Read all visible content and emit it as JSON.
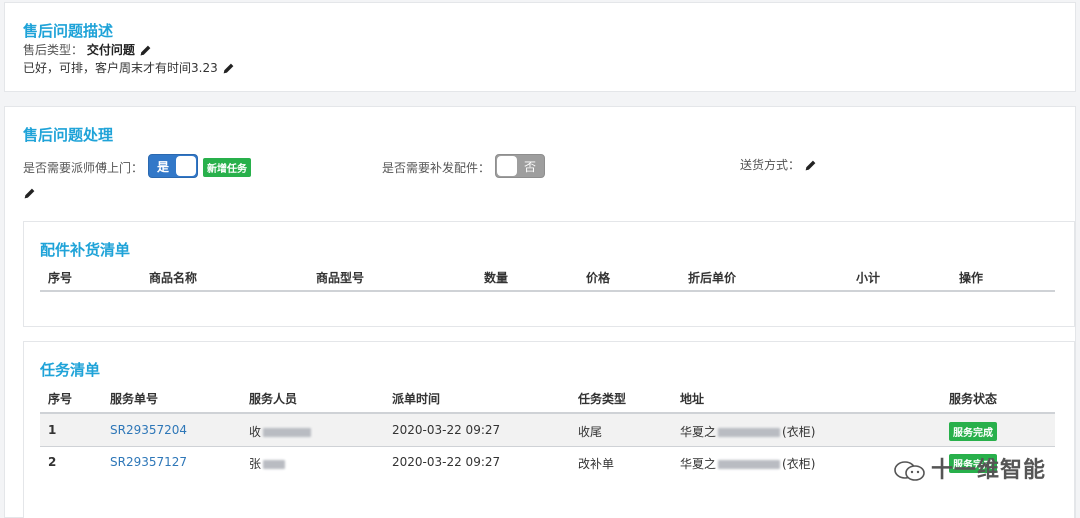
{
  "desc": {
    "title": "售后问题描述",
    "type_label": "售后类型：",
    "type_value": "交付问题",
    "note": "已好，可排，客户周末才有时间3.23"
  },
  "handle": {
    "title": "售后问题处理",
    "dispatch_label": "是否需要派师傅上门：",
    "dispatch_toggle": "是",
    "add_task": "新增任务",
    "parts_label": "是否需要补发配件：",
    "parts_toggle": "否",
    "delivery_label": "送货方式："
  },
  "parts_list": {
    "title": "配件补货清单",
    "columns": [
      "序号",
      "商品名称",
      "商品型号",
      "数量",
      "价格",
      "折后单价",
      "小计",
      "操作"
    ]
  },
  "task_list": {
    "title": "任务清单",
    "columns": [
      "序号",
      "服务单号",
      "服务人员",
      "派单时间",
      "任务类型",
      "地址",
      "服务状态"
    ],
    "rows": [
      {
        "no": "1",
        "order": "SR29357204",
        "staff": "收",
        "time": "2020-03-22 09:27",
        "type": "收尾",
        "addr_pre": "华夏之",
        "addr_post": "(衣柜)",
        "status": "服务完成"
      },
      {
        "no": "2",
        "order": "SR29357127",
        "staff": "张",
        "time": "2020-03-22 09:27",
        "type": "改补单",
        "addr_pre": "华夏之",
        "addr_post": "(衣柜)",
        "status": "服务完成"
      }
    ]
  },
  "watermark": "十一维智能",
  "colors": {
    "accent": "#1fa3d8",
    "toggle_on": "#3278c8",
    "badge": "#28b04b",
    "link": "#2e77b8"
  }
}
